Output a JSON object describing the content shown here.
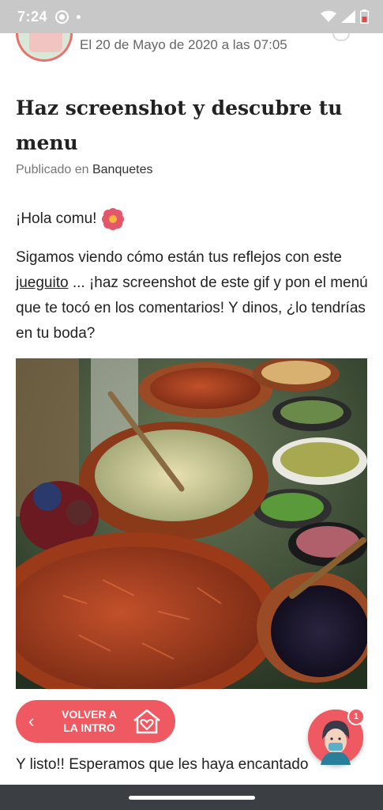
{
  "status_bar": {
    "time": "7:24",
    "icons": [
      "notification-circle-icon",
      "dot-icon",
      "wifi-icon",
      "signal-icon",
      "battery-icon"
    ]
  },
  "post": {
    "date_line": "El 20 de Mayo de 2020 a las 07:05",
    "title": "Haz screenshot y descubre tu menu",
    "published_prefix": "Publicado en",
    "category": "Banquetes",
    "greeting": "¡Hola comu!",
    "body_before": "Sigamos viendo cómo están tus reflejos con este ",
    "body_link": "jueguito",
    "body_after": " ... ¡haz screenshot de este gif y pon el menú que te tocó en los comentarios! Y dinos, ¿lo tendrías en tu boda?",
    "closing": "Y listo!! Esperamos que les haya encantado"
  },
  "back_button": {
    "label": "VOLVER A LA INTRO"
  },
  "chat": {
    "badge_count": "1"
  },
  "colors": {
    "accent": "#ef5a62",
    "status_bar": "#c8c8c8",
    "nav_bar": "#3b3f44"
  }
}
